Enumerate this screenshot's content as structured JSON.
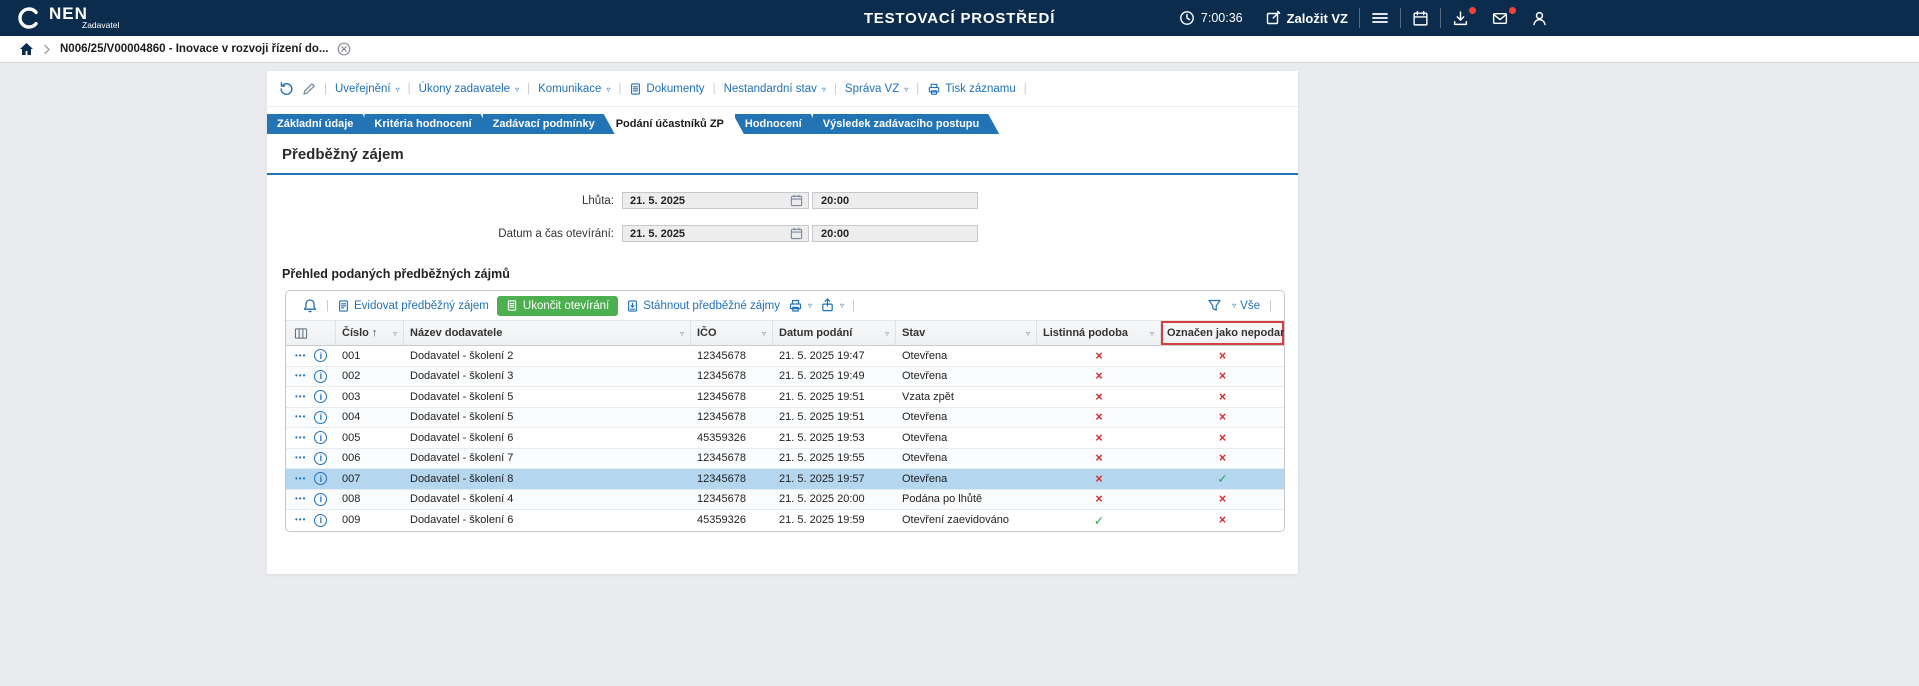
{
  "colors": {
    "topbar_bg": "#0c2c4e",
    "accent_blue": "#2071b8",
    "tab_blue": "#2374b5",
    "green_btn": "#4caf50",
    "red_mark": "#d62c2c",
    "green_mark": "#2fa14b",
    "selected_row": "#b5d6ef",
    "highlight_red": "#d43f3f"
  },
  "icons": {
    "caret": "▿",
    "sort_asc": "↑",
    "dots": "•••",
    "info": "i"
  },
  "header": {
    "brand": "NEN",
    "brand_subtitle": "Zadavatel",
    "environment_title": "TESTOVACÍ PROSTŘEDÍ",
    "clock": "7:00:36",
    "create_vz_label": "Založit VZ"
  },
  "breadcrumb": {
    "record": "N006/25/V00004860 - Inovace v rozvoji řízení do..."
  },
  "record_toolbar": {
    "items": [
      {
        "label": "Uveřejnění",
        "dropdown": true
      },
      {
        "label": "Úkony zadavatele",
        "dropdown": true
      },
      {
        "label": "Komunikace",
        "dropdown": true
      },
      {
        "label": "Dokumenty",
        "dropdown": false
      },
      {
        "label": "Nestandardní stav",
        "dropdown": true
      },
      {
        "label": "Správa VZ",
        "dropdown": true
      },
      {
        "label": "Tisk záznamu",
        "dropdown": false
      }
    ]
  },
  "tabs": [
    {
      "id": "zakladni-udaje",
      "label": "Základní údaje",
      "active": false
    },
    {
      "id": "kriteria-hodnoceni",
      "label": "Kritéria hodnocení",
      "active": false
    },
    {
      "id": "zadavaci-podminky",
      "label": "Zadávací podmínky",
      "active": false
    },
    {
      "id": "podani-ucastniku-zp",
      "label": "Podání účastníků ZP",
      "active": true
    },
    {
      "id": "hodnoceni",
      "label": "Hodnocení",
      "active": false
    },
    {
      "id": "vysledek-zadavaciho-postupu",
      "label": "Výsledek zadávacího postupu",
      "active": false
    }
  ],
  "section": {
    "title": "Předběžný zájem"
  },
  "form": {
    "rows": [
      {
        "label": "Lhůta:",
        "date": "21. 5. 2025",
        "time": "20:00"
      },
      {
        "label": "Datum a čas otevírání:",
        "date": "21. 5. 2025",
        "time": "20:00"
      }
    ]
  },
  "table": {
    "title": "Přehled podaných předběžných zájmů",
    "toolbar": {
      "register_label": "Evidovat předběžný zájem",
      "finish_label": "Ukončit otevírání",
      "download_label": "Stáhnout předběžné zájmy",
      "all_label": "Vše"
    },
    "columns": [
      {
        "label": "Číslo",
        "sorted": true
      },
      {
        "label": "Název dodavatele"
      },
      {
        "label": "IČO"
      },
      {
        "label": "Datum podání"
      },
      {
        "label": "Stav"
      },
      {
        "label": "Listinná podoba"
      },
      {
        "label": "Označen jako nepodaný",
        "highlighted": true
      }
    ],
    "marks": {
      "yes": "✓",
      "no": "×"
    },
    "rows": [
      {
        "cislo": "001",
        "nazev": "Dodavatel - školení 2",
        "ico": "12345678",
        "datum": "21. 5. 2025 19:47",
        "stav": "Otevřena",
        "listinna": false,
        "nepodany": false,
        "selected": false
      },
      {
        "cislo": "002",
        "nazev": "Dodavatel - školení 3",
        "ico": "12345678",
        "datum": "21. 5. 2025 19:49",
        "stav": "Otevřena",
        "listinna": false,
        "nepodany": false,
        "selected": false
      },
      {
        "cislo": "003",
        "nazev": "Dodavatel - školení 5",
        "ico": "12345678",
        "datum": "21. 5. 2025 19:51",
        "stav": "Vzata zpět",
        "listinna": false,
        "nepodany": false,
        "selected": false
      },
      {
        "cislo": "004",
        "nazev": "Dodavatel - školení 5",
        "ico": "12345678",
        "datum": "21. 5. 2025 19:51",
        "stav": "Otevřena",
        "listinna": false,
        "nepodany": false,
        "selected": false
      },
      {
        "cislo": "005",
        "nazev": "Dodavatel - školení 6",
        "ico": "45359326",
        "datum": "21. 5. 2025 19:53",
        "stav": "Otevřena",
        "listinna": false,
        "nepodany": false,
        "selected": false
      },
      {
        "cislo": "006",
        "nazev": "Dodavatel - školení 7",
        "ico": "12345678",
        "datum": "21. 5. 2025 19:55",
        "stav": "Otevřena",
        "listinna": false,
        "nepodany": false,
        "selected": false
      },
      {
        "cislo": "007",
        "nazev": "Dodavatel - školení 8",
        "ico": "12345678",
        "datum": "21. 5. 2025 19:57",
        "stav": "Otevřena",
        "listinna": false,
        "nepodany": true,
        "selected": true
      },
      {
        "cislo": "008",
        "nazev": "Dodavatel - školení 4",
        "ico": "12345678",
        "datum": "21. 5. 2025 20:00",
        "stav": "Podána po lhůtě",
        "listinna": false,
        "nepodany": false,
        "selected": false
      },
      {
        "cislo": "009",
        "nazev": "Dodavatel - školení 6",
        "ico": "45359326",
        "datum": "21. 5. 2025 19:59",
        "stav": "Otevření zaevidováno",
        "listinna": true,
        "nepodany": false,
        "selected": false
      }
    ]
  }
}
